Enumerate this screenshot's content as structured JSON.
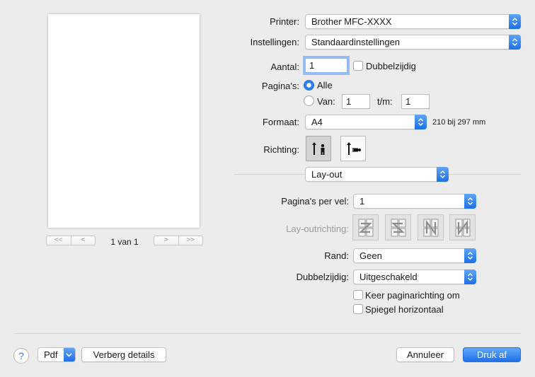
{
  "preview": {
    "nav_first": "<<",
    "nav_prev": "<",
    "nav_next": ">",
    "nav_last": ">>",
    "page_info": "1 van 1"
  },
  "printer": {
    "label": "Printer:",
    "value": "Brother MFC-XXXX"
  },
  "settings": {
    "label": "Instellingen:",
    "value": "Standaardinstellingen"
  },
  "copies": {
    "label": "Aantal:",
    "value": "1",
    "duplex_label": "Dubbelzijdig",
    "duplex_checked": false
  },
  "pages": {
    "label": "Pagina's:",
    "all_label": "Alle",
    "from_label": "Van:",
    "from_value": "1",
    "to_label": "t/m:",
    "to_value": "1",
    "selected": "all"
  },
  "format": {
    "label": "Formaat:",
    "value": "A4",
    "dimensions": "210 bij 297 mm"
  },
  "orientation": {
    "label": "Richting:",
    "selected": "portrait"
  },
  "section": {
    "value": "Lay-out"
  },
  "layout": {
    "pages_per_sheet_label": "Pagina's per vel:",
    "pages_per_sheet_value": "1",
    "direction_label": "Lay-outrichting:",
    "border_label": "Rand:",
    "border_value": "Geen",
    "duplex_label": "Dubbelzijdig:",
    "duplex_value": "Uitgeschakeld",
    "reverse_label": "Keer paginarichting om",
    "reverse_checked": false,
    "mirror_label": "Spiegel horizontaal",
    "mirror_checked": false
  },
  "footer": {
    "help": "?",
    "pdf_label": "Pdf",
    "hide_details_label": "Verberg details",
    "cancel_label": "Annuleer",
    "print_label": "Druk af"
  },
  "colors": {
    "accent": "#1f70ea",
    "background": "#ececec"
  }
}
